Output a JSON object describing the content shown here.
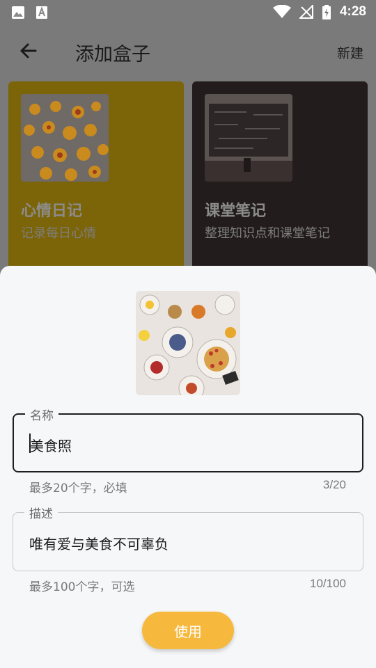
{
  "status_bar": {
    "time": "4:28",
    "left_icons": [
      "image-icon",
      "text-a-icon"
    ],
    "right_icons": [
      "wifi-icon",
      "no-signal-icon",
      "battery-charging-icon"
    ]
  },
  "header": {
    "title": "添加盒子",
    "action_label": "新建"
  },
  "cards": [
    {
      "title": "心情日记",
      "subtitle": "记录每日心情",
      "color": "#7c6408"
    },
    {
      "title": "课堂笔记",
      "subtitle": "整理知识点和课堂笔记",
      "color": "#231c1c"
    }
  ],
  "sheet": {
    "name_field": {
      "label": "名称",
      "value": "美食照",
      "helper": "最多20个字，必填",
      "counter": "3/20"
    },
    "desc_field": {
      "label": "描述",
      "value": "唯有爱与美食不可辜负",
      "helper": "最多100个字，可选",
      "counter": "10/100"
    },
    "use_button": "使用"
  },
  "colors": {
    "accent": "#f6b93e",
    "sheet_bg": "#f6f7f9"
  }
}
